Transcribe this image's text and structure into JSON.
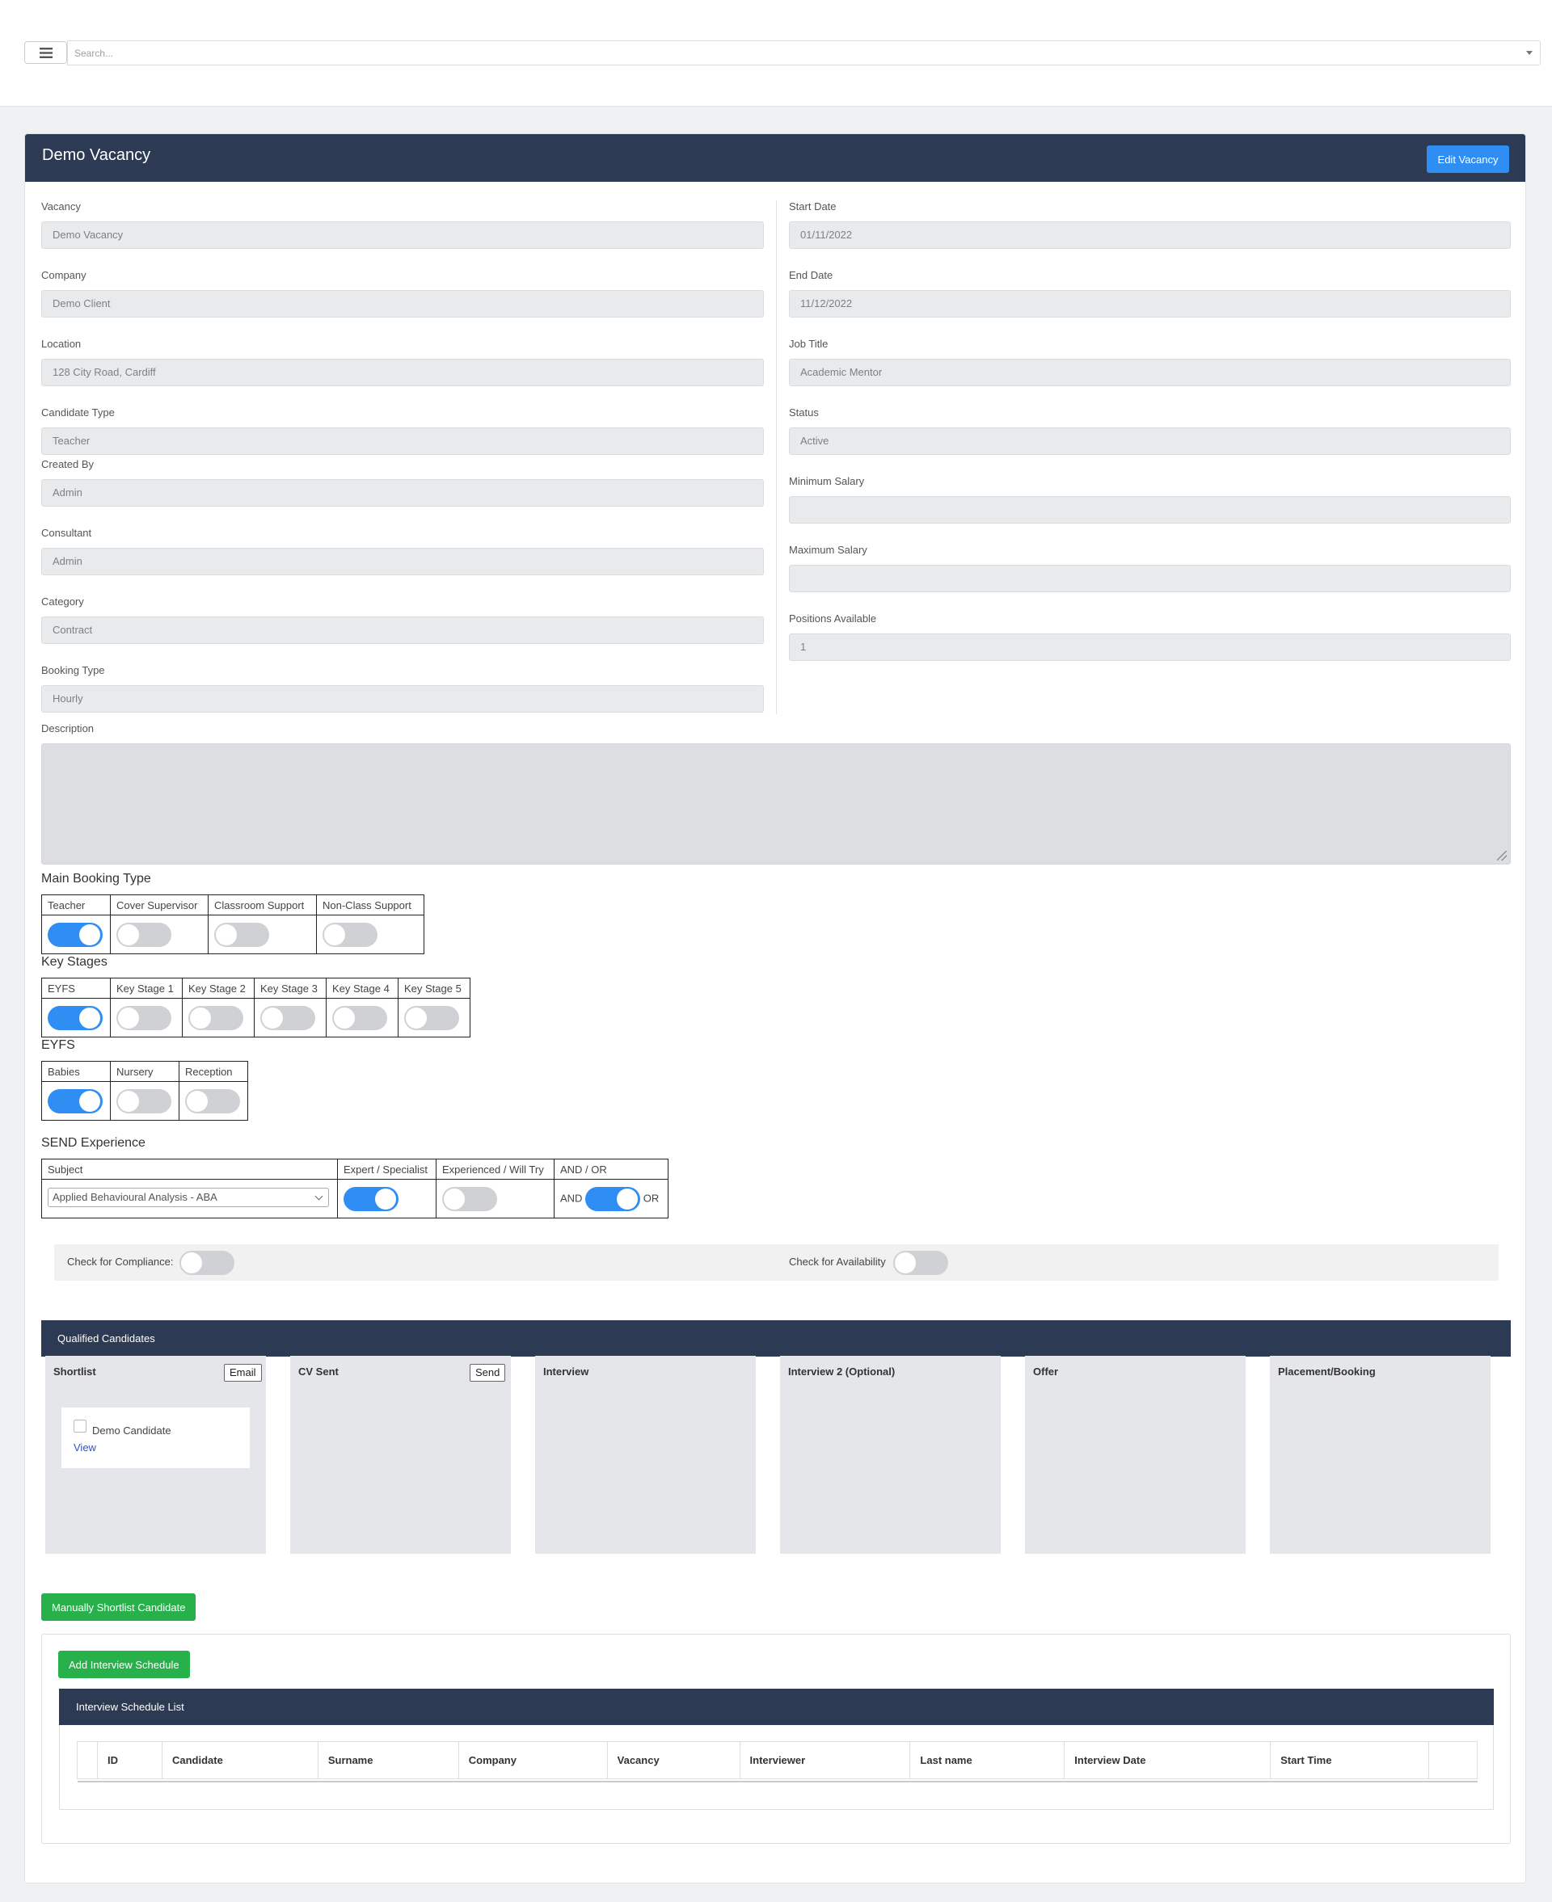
{
  "topbar": {
    "search_placeholder": "Search..."
  },
  "vacancy": {
    "title": "Demo Vacancy",
    "edit_label": "Edit Vacancy",
    "fields_left": [
      {
        "label": "Vacancy",
        "value": "Demo Vacancy"
      },
      {
        "label": "Company",
        "value": "Demo Client"
      },
      {
        "label": "Location",
        "value": "128 City Road, Cardiff"
      },
      {
        "label": "Candidate Type",
        "value": "Teacher"
      },
      {
        "label": "Created By",
        "value": "Admin"
      },
      {
        "label": "Consultant",
        "value": "Admin"
      },
      {
        "label": "Category",
        "value": "Contract"
      },
      {
        "label": "Booking Type",
        "value": "Hourly"
      }
    ],
    "fields_right": [
      {
        "label": "Start Date",
        "value": "01/11/2022"
      },
      {
        "label": "End Date",
        "value": "11/12/2022"
      },
      {
        "label": "Job Title",
        "value": "Academic Mentor"
      },
      {
        "label": "Status",
        "value": "Active"
      },
      {
        "label": "Minimum Salary",
        "value": ""
      },
      {
        "label": "Maximum Salary",
        "value": ""
      },
      {
        "label": "Positions Available",
        "value": "1"
      }
    ],
    "description_label": "Description",
    "description_value": ""
  },
  "main_booking_type": {
    "title": "Main Booking Type",
    "options": [
      {
        "label": "Teacher",
        "on": true
      },
      {
        "label": "Cover Supervisor",
        "on": false
      },
      {
        "label": "Classroom Support",
        "on": false
      },
      {
        "label": "Non-Class Support",
        "on": false
      }
    ]
  },
  "key_stages": {
    "title": "Key Stages",
    "options": [
      {
        "label": "EYFS",
        "on": true
      },
      {
        "label": "Key Stage 1",
        "on": false
      },
      {
        "label": "Key Stage 2",
        "on": false
      },
      {
        "label": "Key Stage 3",
        "on": false
      },
      {
        "label": "Key Stage 4",
        "on": false
      },
      {
        "label": "Key Stage 5",
        "on": false
      }
    ]
  },
  "eyfs": {
    "title": "EYFS",
    "options": [
      {
        "label": "Babies",
        "on": true
      },
      {
        "label": "Nursery",
        "on": false
      },
      {
        "label": "Reception",
        "on": false
      }
    ]
  },
  "send": {
    "title": "SEND Experience",
    "headers": [
      "Subject",
      "Expert / Specialist",
      "Experienced / Will Try",
      "AND / OR"
    ],
    "subject_value": "Applied Behavioural Analysis - ABA",
    "expert_on": true,
    "experienced_on": false,
    "and_label": "AND",
    "or_label": "OR",
    "andor_on": true
  },
  "checks": {
    "compliance_label": "Check for Compliance:",
    "compliance_on": false,
    "availability_label": "Check for Availability",
    "availability_on": false
  },
  "qualified": {
    "title": "Qualified Candidates",
    "stages": [
      {
        "title": "Shortlist",
        "button": "Email"
      },
      {
        "title": "CV Sent",
        "button": "Send"
      },
      {
        "title": "Interview",
        "button": ""
      },
      {
        "title": "Interview 2 (Optional)",
        "button": ""
      },
      {
        "title": "Offer",
        "button": ""
      },
      {
        "title": "Placement/Booking",
        "button": ""
      }
    ],
    "candidate_name": "Demo Candidate",
    "candidate_view": "View"
  },
  "actions": {
    "manual_shortlist": "Manually Shortlist Candidate",
    "add_interview": "Add Interview Schedule"
  },
  "interview_list": {
    "title": "Interview Schedule List",
    "columns": [
      "",
      "ID",
      "Candidate",
      "Surname",
      "Company",
      "Vacancy",
      "Interviewer",
      "Last name",
      "Interview Date",
      "Start Time",
      ""
    ]
  },
  "colors": {
    "header_bg": "#2d3a53",
    "accent_blue": "#2f8ef4",
    "success_green": "#28b04b"
  }
}
